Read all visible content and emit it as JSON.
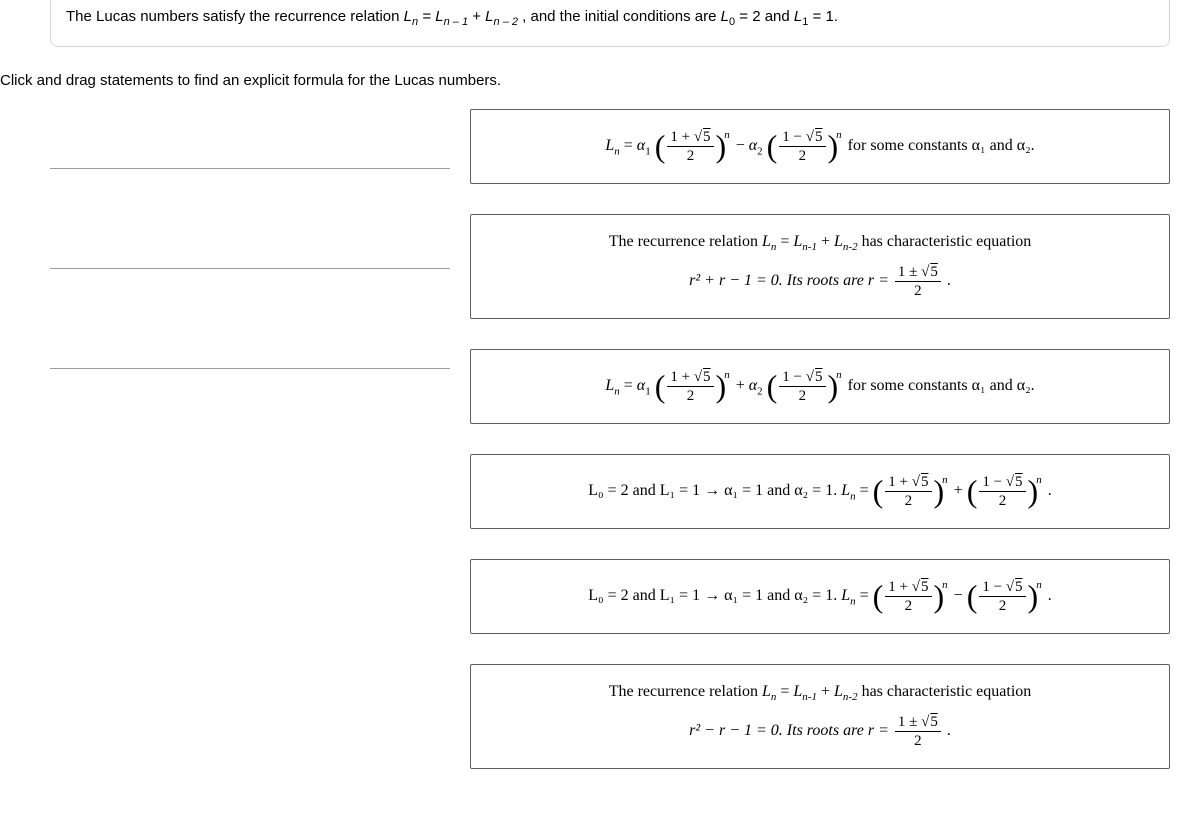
{
  "intro": {
    "prefix": "The Lucas numbers satisfy the recurrence relation ",
    "rec_left": "L",
    "rec_sub_n": "n",
    "eq": " = ",
    "rec_r1_sub": "n – 1",
    "plus": " + ",
    "rec_r2_sub": "n – 2",
    "suffix": ", and the initial conditions are ",
    "init_l0_sub": "0",
    "init_l0_val": " = 2 and ",
    "init_l1_sub": "1",
    "init_l1_val": " = 1."
  },
  "instruction": "Click and drag statements to find an explicit formula for the Lucas numbers.",
  "frac_parts": {
    "num_plus": "1 + ",
    "num_minus": "1 − ",
    "five": "5",
    "den": "2",
    "one_pm": "1 ± "
  },
  "labels": {
    "Ln_eq_a1": "L",
    "n_sub": "n",
    "eq": " = ",
    "alpha": "α",
    "one_sub": "1",
    "two_sub": "2",
    "minus": " − ",
    "plus": " + ",
    "tail_const": " for some constants α₁ and α₂.",
    "rec_line1": "The recurrence relation ",
    "Ln": "L",
    "nsub": "n",
    "nm1": "n-1",
    "nm2": "n-2",
    "rec_tail": " has characteristic equation",
    "r2_plus": "r² + r − 1 = 0. Its roots are r = ",
    "r2_minus": "r² − r − 1 = 0. Its roots are r = ",
    "initcond_pre": "L₀ = 2 and L₁ = 1 → α₁ = 1 and α₂ = 1.  ",
    "period": " ."
  }
}
